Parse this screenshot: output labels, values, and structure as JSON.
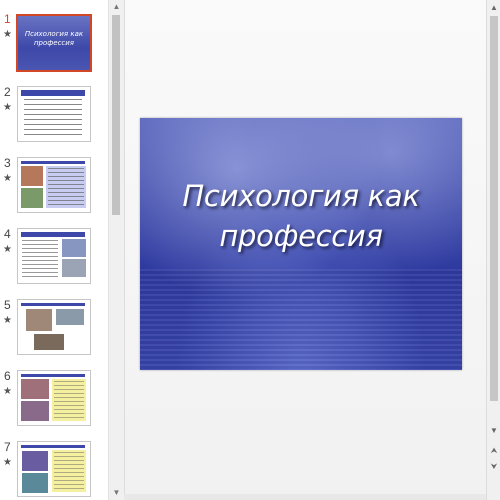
{
  "slides": [
    {
      "number": "1",
      "star": "★",
      "title": "Психология как профессия"
    },
    {
      "number": "2",
      "star": "★"
    },
    {
      "number": "3",
      "star": "★"
    },
    {
      "number": "4",
      "star": "★"
    },
    {
      "number": "5",
      "star": "★"
    },
    {
      "number": "6",
      "star": "★"
    },
    {
      "number": "7",
      "star": "★"
    }
  ],
  "active_slide": "1",
  "main_slide": {
    "title": "Психология как профессия"
  },
  "scroll_icons": {
    "up": "scroll-up-icon",
    "down": "scroll-down-icon",
    "prev": "previous-slide-icon",
    "next": "next-slide-icon"
  }
}
